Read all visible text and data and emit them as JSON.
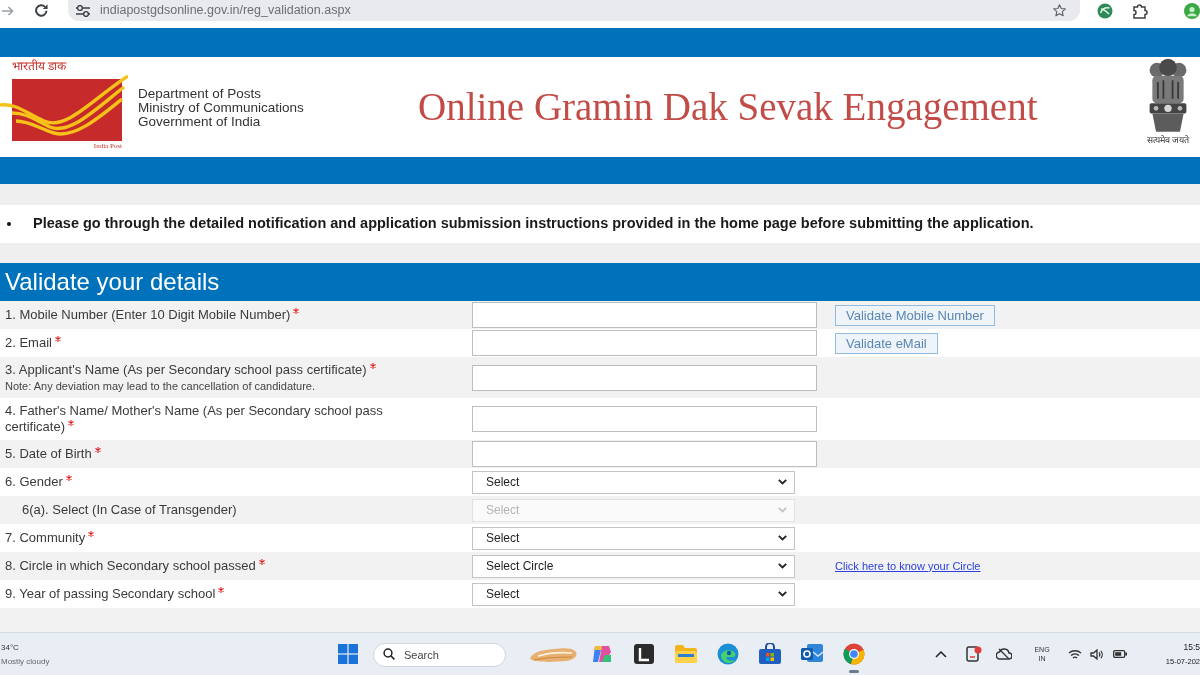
{
  "browser": {
    "url": "indiapostgdsonline.gov.in/reg_validation.aspx"
  },
  "header": {
    "logo_script": "भारतीय डाक",
    "logo_caption": "India Post",
    "organization_lines": [
      "Department of Posts",
      "Ministry of Communications",
      "Government of India"
    ],
    "title": "Online Gramin Dak Sevak Engagement",
    "emblem_caption": "सत्यमेव जयते"
  },
  "notice": {
    "items": [
      "Please go through the detailed notification and application submission instructions provided in the home page before submitting the application."
    ]
  },
  "form": {
    "title": "Validate your details",
    "rows": [
      {
        "label": "1. Mobile Number (Enter 10 Digit Mobile Number)",
        "required": true,
        "field": {
          "kind": "text",
          "disabled": false
        },
        "action": {
          "kind": "button",
          "label": "Validate Mobile Number"
        }
      },
      {
        "label": "2. Email",
        "required": true,
        "field": {
          "kind": "text",
          "disabled": false
        },
        "action": {
          "kind": "button",
          "label": "Validate eMail"
        }
      },
      {
        "label": "3. Applicant's Name (As per Secondary school pass certificate)",
        "required": true,
        "note": "Note: Any deviation may lead to the cancellation of candidature.",
        "field": {
          "kind": "text",
          "disabled": false
        }
      },
      {
        "label": "4. Father's Name/ Mother's Name (As per Secondary school pass certificate)",
        "required": true,
        "field": {
          "kind": "text",
          "disabled": false
        }
      },
      {
        "label": "5. Date of Birth",
        "required": true,
        "field": {
          "kind": "text",
          "disabled": false
        }
      },
      {
        "label": "6. Gender",
        "required": true,
        "field": {
          "kind": "select",
          "value": "Select",
          "disabled": false
        },
        "children": [
          {
            "label": "6(a). Select (In Case of Transgender)",
            "required": false,
            "field": {
              "kind": "select",
              "value": "Select",
              "disabled": true
            }
          }
        ]
      },
      {
        "label": "7. Community",
        "required": true,
        "field": {
          "kind": "select",
          "value": "Select",
          "disabled": false
        }
      },
      {
        "label": "8. Circle in which Secondary school passed",
        "required": true,
        "field": {
          "kind": "select",
          "value": "Select Circle",
          "disabled": false
        },
        "action": {
          "kind": "link",
          "label": "Click here to know your Circle"
        }
      },
      {
        "label": "9. Year of passing Secondary school",
        "required": true,
        "field": {
          "kind": "select",
          "value": "Select",
          "disabled": false
        }
      }
    ]
  },
  "taskbar": {
    "weather": {
      "temperature": "34°C",
      "condition": "Mostly cloudy"
    },
    "search": {
      "placeholder": "Search"
    },
    "apps": [
      {
        "kind": "sparkle",
        "active": false
      },
      {
        "kind": "panel",
        "active": false
      },
      {
        "kind": "folder",
        "active": false
      },
      {
        "kind": "swirl",
        "active": false
      },
      {
        "kind": "bag",
        "active": false
      },
      {
        "kind": "mail",
        "active": false
      },
      {
        "kind": "browser",
        "active": true
      }
    ],
    "language": [
      "ENG",
      "IN"
    ],
    "clock": {
      "time": "15:5",
      "date": "15-07-202"
    }
  }
}
